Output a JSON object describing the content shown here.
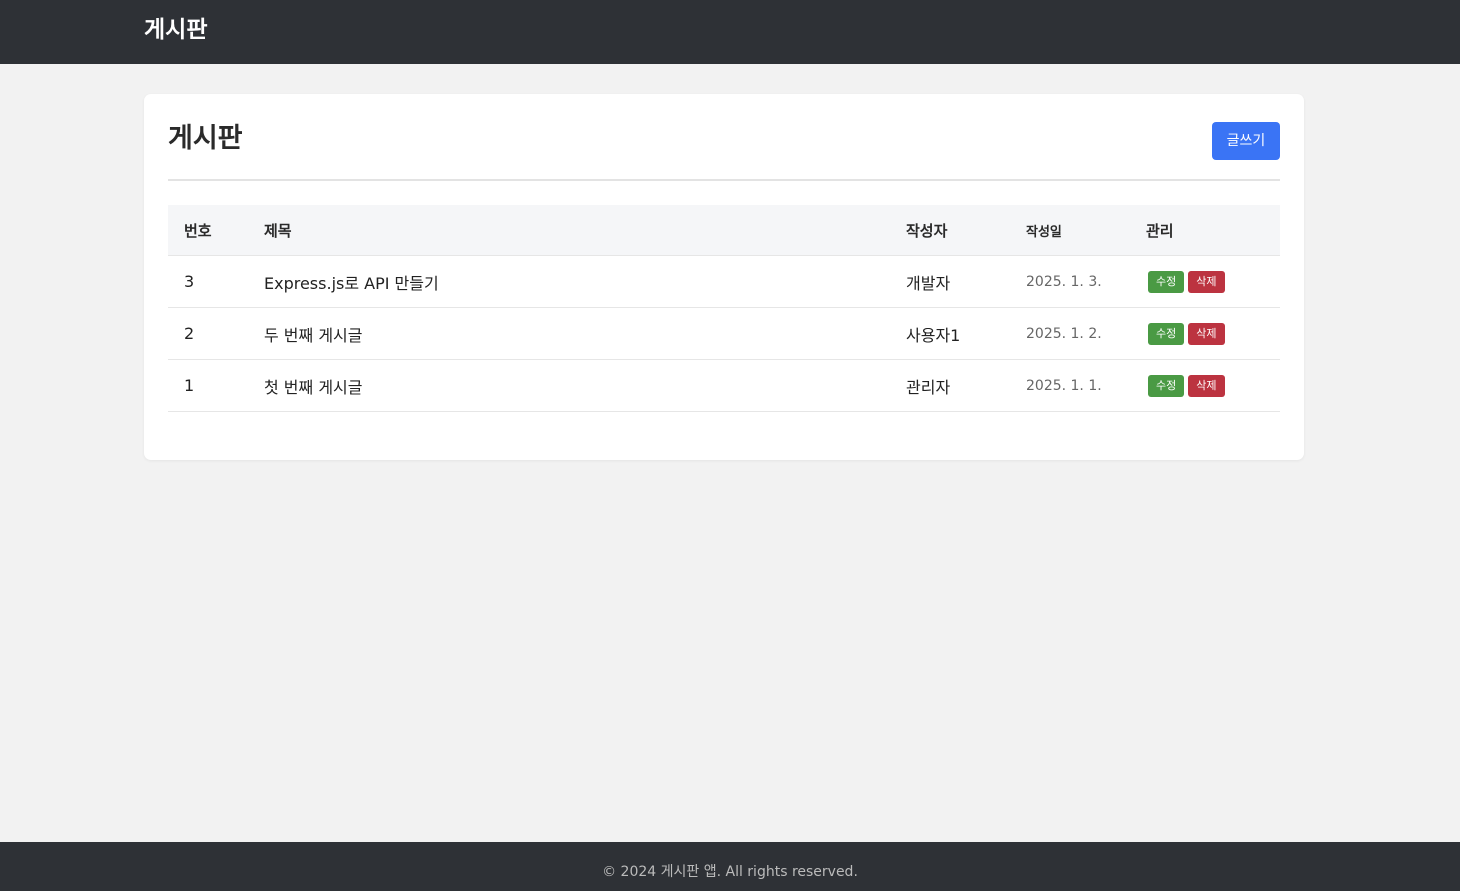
{
  "navbar": {
    "brand": "게시판"
  },
  "board": {
    "title": "게시판",
    "write_button": "글쓰기",
    "columns": {
      "number": "번호",
      "title": "제목",
      "author": "작성자",
      "date": "작성일",
      "manage": "관리"
    },
    "rows": [
      {
        "number": "3",
        "title": "Express.js로 API 만들기",
        "author": "개발자",
        "date": "2025. 1. 3.",
        "edit": "수정",
        "delete": "삭제"
      },
      {
        "number": "2",
        "title": "두 번째 게시글",
        "author": "사용자1",
        "date": "2025. 1. 2.",
        "edit": "수정",
        "delete": "삭제"
      },
      {
        "number": "1",
        "title": "첫 번째 게시글",
        "author": "관리자",
        "date": "2025. 1. 1.",
        "edit": "수정",
        "delete": "삭제"
      }
    ]
  },
  "footer": {
    "text": "© 2024 게시판 앱. All rights reserved."
  },
  "colors": {
    "navbar": "#2e3136",
    "primary": "#3a74f5",
    "edit": "#4a9a44",
    "delete": "#bc3340",
    "background": "#f2f2f2"
  }
}
